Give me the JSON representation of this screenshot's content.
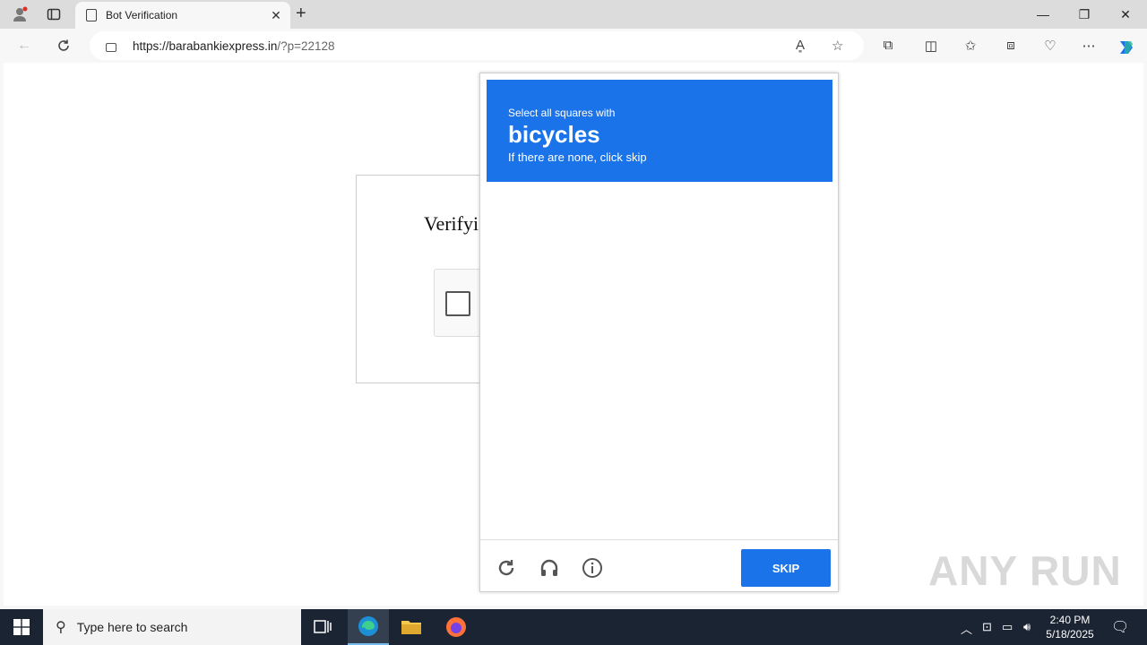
{
  "browser": {
    "tab_title": "Bot Verification",
    "url_host": "https://barabankiexpress.in",
    "url_path": "/?p=22128"
  },
  "page": {
    "verify_title": "Verifyi"
  },
  "captcha": {
    "prompt_pre": "Select all squares with",
    "prompt_object": "bicycles",
    "prompt_post": "If there are none, click skip",
    "tiles": [
      "",
      "",
      "",
      "",
      "",
      "",
      "",
      "",
      "",
      "",
      "",
      "",
      "",
      "",
      "",
      ""
    ],
    "skip_label": "SKIP",
    "accent": "#1a73e8"
  },
  "watermark": "ANY RUN",
  "taskbar": {
    "search_placeholder": "Type here to search",
    "time": "2:40 PM",
    "date": "5/18/2025"
  }
}
